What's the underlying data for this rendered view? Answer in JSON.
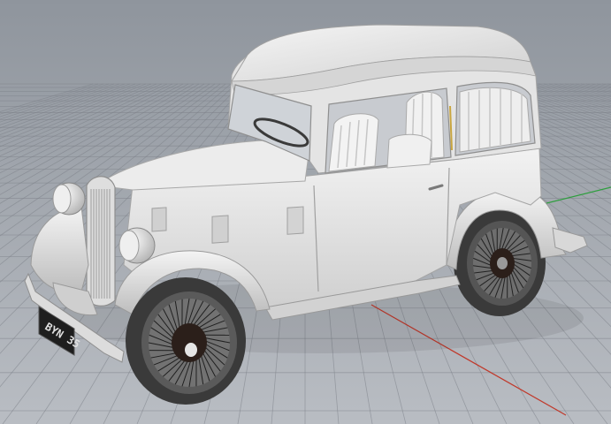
{
  "viewport": {
    "background_top": "#8f959d",
    "background_bottom": "#b9bdc3",
    "grid_color": "#7c8088",
    "axis_x_color": "#c0392b",
    "axis_y_color": "#2e9e3e"
  },
  "model": {
    "body_color": "#e6e6e6",
    "shade_color": "#c9c9c9",
    "dark_shade_color": "#a9a9a9",
    "tire_color": "#3a3a3a",
    "hub_color": "#2b1f1a",
    "license_plate": "BYN 35"
  }
}
